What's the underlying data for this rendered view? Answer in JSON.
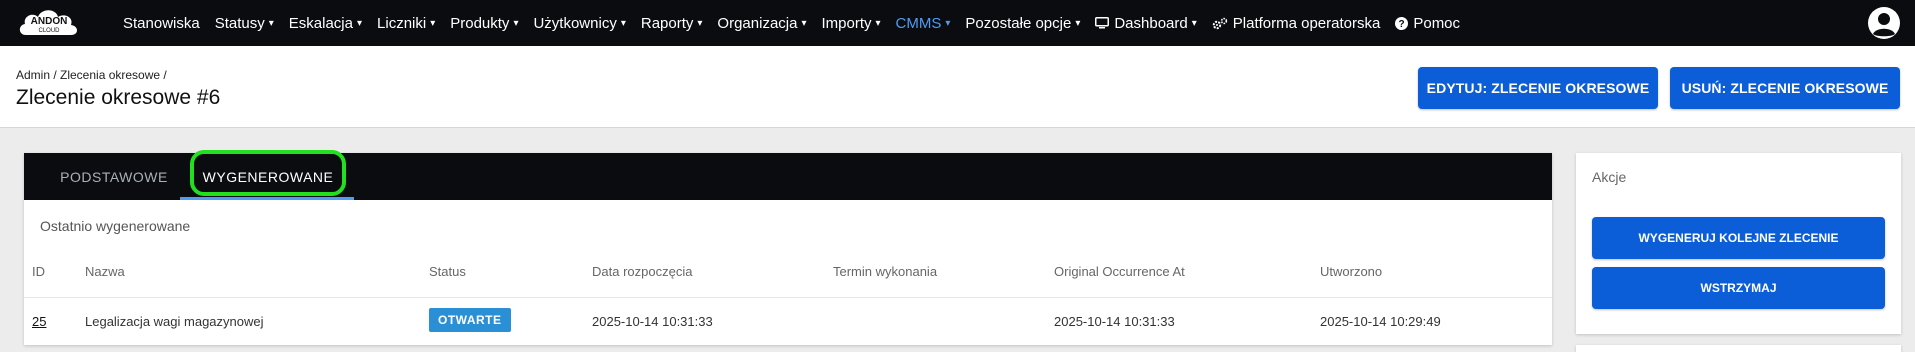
{
  "app": {
    "logo_text": "ANDON CLOUD"
  },
  "nav": {
    "items": [
      {
        "label": "Stanowiska",
        "caret": ""
      },
      {
        "label": "Statusy",
        "caret": "▾"
      },
      {
        "label": "Eskalacja",
        "caret": "▾"
      },
      {
        "label": "Liczniki",
        "caret": "▾"
      },
      {
        "label": "Produkty",
        "caret": "▾"
      },
      {
        "label": "Użytkownicy",
        "caret": "▾"
      },
      {
        "label": "Raporty",
        "caret": "▾"
      },
      {
        "label": "Organizacja",
        "caret": "▾"
      },
      {
        "label": "Importy",
        "caret": "▾"
      },
      {
        "label": "CMMS",
        "caret": "▾"
      },
      {
        "label": "Pozostałe opcje",
        "caret": "▾"
      },
      {
        "label": "Dashboard",
        "caret": "▾"
      },
      {
        "label": "Platforma operatorska",
        "caret": ""
      },
      {
        "label": "Pomoc",
        "caret": ""
      }
    ],
    "active_color": "#4f9cf5"
  },
  "header": {
    "breadcrumb": "Admin / Zlecenia okresowe /",
    "title": "Zlecenie okresowe #6",
    "edit_button": "EDYTUJ: ZLECENIE OKRESOWE",
    "delete_button": "USUŃ: ZLECENIE OKRESOWE"
  },
  "tabs": {
    "basic": "PODSTAWOWE",
    "generated": "WYGENEROWANE"
  },
  "generated": {
    "section_label": "Ostatnio wygenerowane",
    "columns": {
      "id": "ID",
      "name": "Nazwa",
      "status": "Status",
      "start": "Data rozpoczęcia",
      "due": "Termin wykonania",
      "original": "Original Occurrence At",
      "created": "Utworzono"
    },
    "rows": [
      {
        "id": "25",
        "name": "Legalizacja wagi magazynowej",
        "status": "OTWARTE",
        "start": "2025-10-14 10:31:33",
        "due": "",
        "original": "2025-10-14 10:31:33",
        "created": "2025-10-14 10:29:49"
      }
    ]
  },
  "actions": {
    "title": "Akcje",
    "generate_next": "WYGENERUJ KOLEJNE ZLECENIE",
    "hold": "WSTRZYMAJ"
  },
  "colors": {
    "primary": "#0b5ed7",
    "nav_bg": "#0a0c10",
    "highlight": "#22e01f",
    "badge": "#2b8fd6"
  }
}
